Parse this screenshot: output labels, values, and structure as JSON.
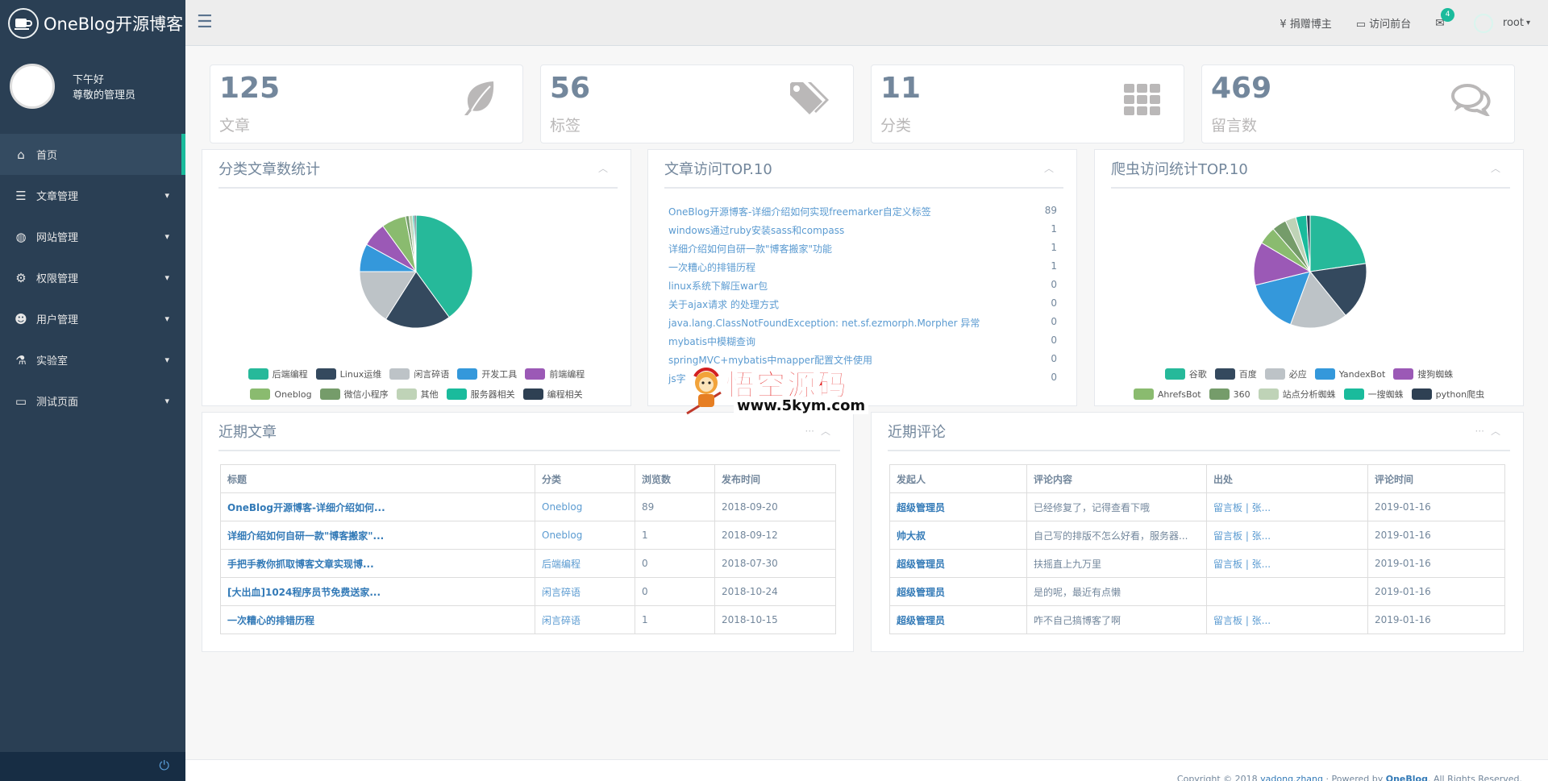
{
  "brand": {
    "title": "OneBlog开源博客"
  },
  "profile": {
    "greeting": "下午好",
    "name": "尊敬的管理员"
  },
  "menu": [
    {
      "label": "首页",
      "icon": "home-icon",
      "active": true
    },
    {
      "label": "文章管理",
      "icon": "list-icon"
    },
    {
      "label": "网站管理",
      "icon": "globe-icon"
    },
    {
      "label": "权限管理",
      "icon": "cogs-icon"
    },
    {
      "label": "用户管理",
      "icon": "users-icon"
    },
    {
      "label": "实验室",
      "icon": "flask-icon"
    },
    {
      "label": "测试页面",
      "icon": "desktop-icon"
    }
  ],
  "topnav": {
    "donate": "¥ 捐赠博主",
    "visit": "访问前台",
    "mail_count": "4",
    "user": "root"
  },
  "stats": [
    {
      "value": "125",
      "label": "文章",
      "icon": "leaf-icon"
    },
    {
      "value": "56",
      "label": "标签",
      "icon": "tags-icon"
    },
    {
      "value": "11",
      "label": "分类",
      "icon": "grid-icon"
    },
    {
      "value": "469",
      "label": "留言数",
      "icon": "comments-icon"
    }
  ],
  "panels": {
    "category_stats": "分类文章数统计",
    "top_articles": "文章访问TOP.10",
    "spider_stats": "爬虫访问统计TOP.10",
    "recent_articles": "近期文章",
    "recent_comments": "近期评论"
  },
  "colors": {
    "teal": "#26b99a",
    "navy": "#34495e",
    "grey": "#bdc3c7",
    "blue": "#3498db",
    "purple": "#9b59b6",
    "green": "#8abb6f",
    "olive": "#759c6a",
    "pale": "#bfd3b7",
    "aqua": "#1abb9c",
    "dark": "#2e4053"
  },
  "chart_data": [
    {
      "type": "pie",
      "categories": [
        "后端编程",
        "Linux运维",
        "闲言碎语",
        "开发工具",
        "前端编程",
        "Oneblog",
        "微信小程序",
        "其他",
        "服务器相关",
        "编程相关"
      ],
      "values": [
        40,
        19,
        16,
        8,
        7,
        7,
        1,
        1,
        0.5,
        0.5
      ],
      "colors": [
        "#26b99a",
        "#34495e",
        "#bdc3c7",
        "#3498db",
        "#9b59b6",
        "#8abb6f",
        "#759c6a",
        "#bfd3b7",
        "#1abb9c",
        "#2e4053"
      ]
    },
    {
      "type": "table",
      "title": "文章访问TOP.10",
      "rows": [
        {
          "title": "OneBlog开源博客-详细介绍如何实现freemarker自定义标签",
          "count": "89"
        },
        {
          "title": "windows通过ruby安装sass和compass",
          "count": "1"
        },
        {
          "title": "详细介绍如何自研一款\"博客搬家\"功能",
          "count": "1"
        },
        {
          "title": "一次糟心的排错历程",
          "count": "1"
        },
        {
          "title": "linux系统下解压war包",
          "count": "0"
        },
        {
          "title": "关于ajax请求 的处理方式",
          "count": "0"
        },
        {
          "title": "java.lang.ClassNotFoundException: net.sf.ezmorph.Morpher 异常",
          "count": "0"
        },
        {
          "title": "mybatis中模糊查询",
          "count": "0"
        },
        {
          "title": "springMVC+mybatis中mapper配置文件使用",
          "count": "0"
        },
        {
          "title": "js字",
          "count": "0"
        }
      ]
    },
    {
      "type": "pie",
      "categories": [
        "谷歌",
        "百度",
        "必应",
        "YandexBot",
        "搜狗蜘蛛",
        "AhrefsBot",
        "360",
        "站点分析蜘蛛",
        "一搜蜘蛛",
        "python爬虫"
      ],
      "values": [
        22,
        16,
        16,
        15,
        12,
        5,
        4,
        3,
        3,
        1
      ],
      "colors": [
        "#26b99a",
        "#34495e",
        "#bdc3c7",
        "#3498db",
        "#9b59b6",
        "#8abb6f",
        "#759c6a",
        "#bfd3b7",
        "#1abb9c",
        "#2e4053"
      ]
    }
  ],
  "recent_articles": {
    "headers": [
      "标题",
      "分类",
      "浏览数",
      "发布时间"
    ],
    "rows": [
      [
        "OneBlog开源博客-详细介绍如何...",
        "Oneblog",
        "89",
        "2018-09-20"
      ],
      [
        "详细介绍如何自研一款\"博客搬家\"...",
        "Oneblog",
        "1",
        "2018-09-12"
      ],
      [
        "手把手教你抓取博客文章实现博...",
        "后端编程",
        "0",
        "2018-07-30"
      ],
      [
        "[大出血]1024程序员节免费送家...",
        "闲言碎语",
        "0",
        "2018-10-24"
      ],
      [
        "一次糟心的排错历程",
        "闲言碎语",
        "1",
        "2018-10-15"
      ]
    ]
  },
  "recent_comments": {
    "headers": [
      "发起人",
      "评论内容",
      "出处",
      "评论时间"
    ],
    "rows": [
      [
        "超级管理员",
        "已经修复了，记得查看下哦",
        "留言板 | 张...",
        "2019-01-16"
      ],
      [
        "帅大叔",
        "自己写的排版不怎么好看，服务器...",
        "留言板 | 张...",
        "2019-01-16"
      ],
      [
        "超级管理员",
        "扶摇直上九万里",
        "留言板 | 张...",
        "2019-01-16"
      ],
      [
        "超级管理员",
        "是的呢，最近有点懒",
        "",
        "2019-01-16"
      ],
      [
        "超级管理员",
        "咋不自己搞博客了啊",
        "留言板 | 张...",
        "2019-01-16"
      ]
    ]
  },
  "watermark": {
    "title": "悟空源码",
    "url": "www.5kym.com"
  },
  "footer": {
    "prefix": "Copyright © 2018 ",
    "author": "yadong.zhang",
    "mid": " · Powered by ",
    "product": "OneBlog",
    "suffix": ". All Rights Reserved."
  }
}
